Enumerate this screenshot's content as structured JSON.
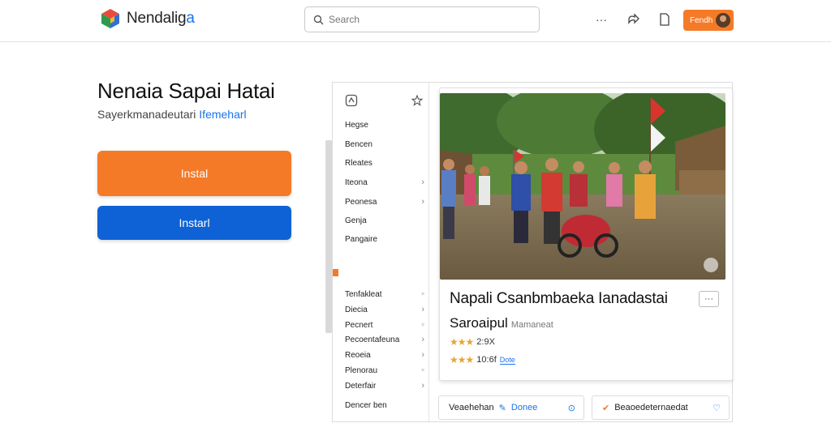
{
  "header": {
    "logo_text": "Nendalig",
    "logo_accent": "a",
    "search_placeholder": "Search",
    "more_label": "···",
    "user_label": "Fendh"
  },
  "hero": {
    "title": "Nenaia Sapai Hatai",
    "subtitle": "Sayerkmanadeutari",
    "subtitle_link": "Ifemeharl",
    "install_primary": "Instal",
    "install_secondary": "Instarl"
  },
  "sidenav": {
    "items_top": [
      {
        "label": "Hegse",
        "chevron": ""
      },
      {
        "label": "Bencen",
        "chevron": ""
      },
      {
        "label": "Rleates",
        "chevron": ""
      },
      {
        "label": "Iteona",
        "chevron": "›"
      },
      {
        "label": "Peonesa",
        "chevron": "›"
      },
      {
        "label": "Genja",
        "chevron": ""
      },
      {
        "label": "Pangaire",
        "chevron": ""
      }
    ],
    "items_bottom": [
      {
        "label": "Tenfakleat",
        "chevron": "◦"
      },
      {
        "label": "Diecia",
        "chevron": "›"
      },
      {
        "label": "Pecnert",
        "chevron": "◦"
      },
      {
        "label": "Pecoentafeuna",
        "chevron": "›"
      },
      {
        "label": "Reoeia",
        "chevron": "›"
      },
      {
        "label": "Plenorau",
        "chevron": "◦"
      },
      {
        "label": "Deterfair",
        "chevron": "›"
      },
      {
        "label": "Dencer ben",
        "chevron": ""
      }
    ]
  },
  "card": {
    "title": "Napali Csanbmbaeka Ianadastai",
    "subtitle": "Saroaipul",
    "subtitle_muted": "Mamaneat",
    "more_label": "···",
    "rating1_stars": "★★★",
    "rating1_text": "2:9X",
    "rating2_stars": "★★★",
    "rating2_text": "10:6f",
    "rating2_link": "Dote"
  },
  "bottom_cards": [
    {
      "label": "Veaehehan",
      "link": "Donee"
    },
    {
      "label": "Beaoedeternaedat",
      "link": ""
    }
  ],
  "colors": {
    "accent_orange": "#f57a28",
    "accent_blue": "#0f62d6",
    "link_blue": "#1a73e8"
  }
}
